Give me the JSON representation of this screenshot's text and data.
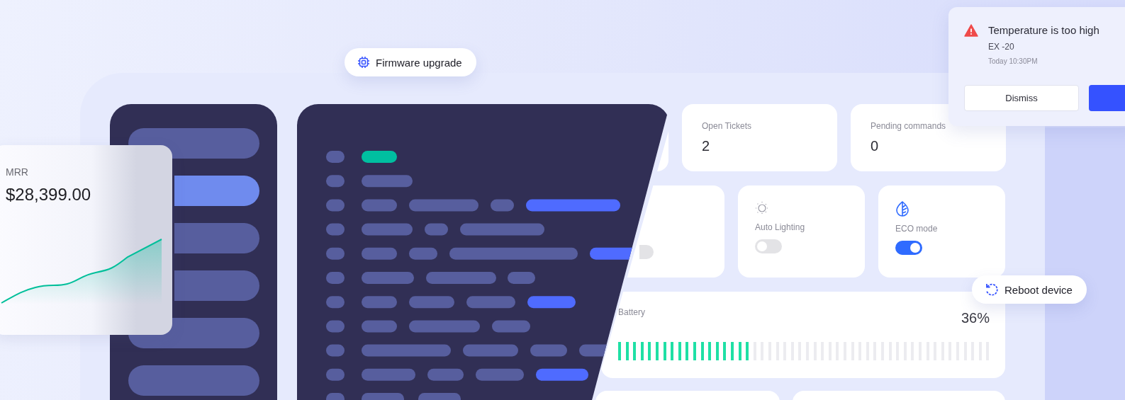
{
  "firmware_chip": {
    "label": "Firmware upgrade"
  },
  "mrr_card": {
    "label": "MRR",
    "value": "$28,399.00"
  },
  "sidebar": {
    "items": [
      {
        "selected": false
      },
      {
        "selected": true
      },
      {
        "selected": false
      },
      {
        "selected": false
      },
      {
        "selected": false
      },
      {
        "selected": false
      }
    ]
  },
  "stats": [
    {
      "label": "Open Tickets",
      "value": "2"
    },
    {
      "label": "Pending commands",
      "value": "0"
    }
  ],
  "controls": [
    {
      "kind": "plain",
      "on": false
    },
    {
      "kind": "sun",
      "label": "Auto Lighting",
      "on": false
    },
    {
      "kind": "leaf",
      "label": "ECO mode",
      "on": true
    }
  ],
  "battery": {
    "label": "Battery",
    "reading": "36%",
    "level": 0.36
  },
  "reboot_chip": {
    "label": "Reboot device"
  },
  "alert": {
    "title": "Temperature is too high",
    "device": "EX -20",
    "time": "Today 10:30PM",
    "buttons": [
      "Dismiss"
    ]
  }
}
